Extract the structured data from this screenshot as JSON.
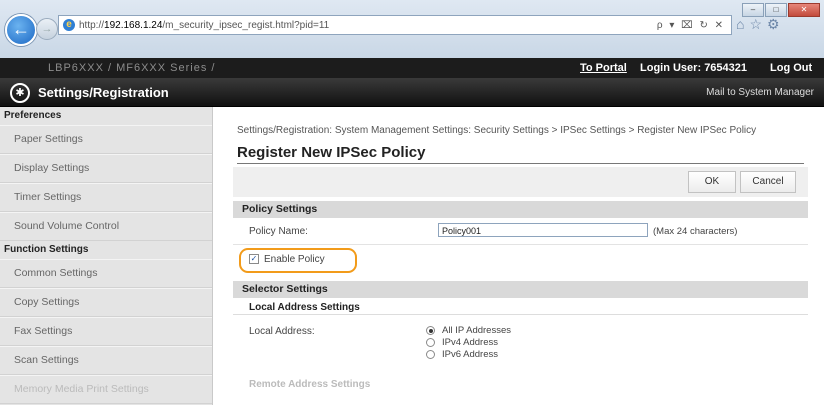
{
  "browser": {
    "url_host": "192.168.1.24",
    "url_path": "/m_security_ipsec_regist.html?pid=11",
    "addr_controls": "ρ ▾ ⌧ ↻ ✕"
  },
  "topbar": {
    "device_name": "LBP6XXX / MF6XXX Series /",
    "portal_link": "To Portal",
    "login_label": "Login User:",
    "login_user": "7654321",
    "logout": "Log Out"
  },
  "titlebar": {
    "title": "Settings/Registration",
    "mail_link": "Mail to System Manager"
  },
  "sidebar": {
    "preferences_header": "Preferences",
    "preferences_items": [
      {
        "label": "Paper Settings"
      },
      {
        "label": "Display Settings"
      },
      {
        "label": "Timer Settings"
      },
      {
        "label": "Sound Volume Control"
      }
    ],
    "function_header": "Function Settings",
    "function_items": [
      {
        "label": "Common Settings"
      },
      {
        "label": "Copy Settings"
      },
      {
        "label": "Fax Settings"
      },
      {
        "label": "Scan Settings"
      },
      {
        "label": "Memory Media Print Settings"
      }
    ]
  },
  "main": {
    "breadcrumb": "Settings/Registration: System Management Settings: Security Settings > IPSec Settings > Register New IPSec Policy",
    "page_title": "Register New IPSec Policy",
    "ok_label": "OK",
    "cancel_label": "Cancel",
    "policy_settings": {
      "header": "Policy Settings",
      "name_label": "Policy Name:",
      "name_value": "Policy001",
      "name_hint": "(Max 24 characters)",
      "enable_label": "Enable Policy",
      "enable_checked": true
    },
    "selector_settings": {
      "header": "Selector Settings",
      "local_header": "Local Address Settings",
      "local_label": "Local Address:",
      "local_options": [
        {
          "label": "All IP Addresses",
          "selected": true
        },
        {
          "label": "IPv4 Address",
          "selected": false
        },
        {
          "label": "IPv6 Address",
          "selected": false
        }
      ],
      "remote_header": "Remote Address Settings"
    }
  },
  "colors": {
    "highlight": "#f29b1a",
    "titlebar": "#111111"
  }
}
